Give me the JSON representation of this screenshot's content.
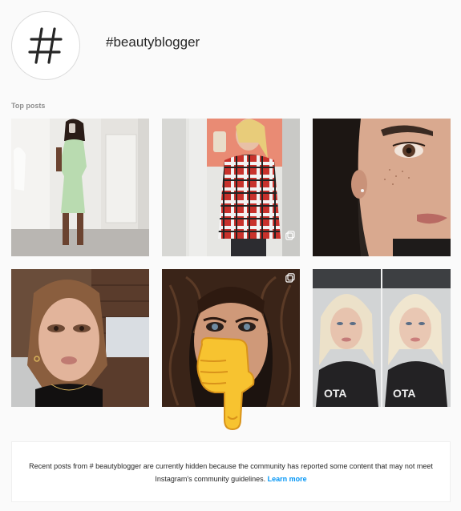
{
  "hashtag": {
    "title": "#beautyblogger",
    "icon": "hashtag-icon"
  },
  "top_posts": {
    "label": "Top posts",
    "posts": [
      {
        "subject": "woman in green dress mirror selfie"
      },
      {
        "subject": "woman in plaid shirt mirror selfie"
      },
      {
        "subject": "close-up of freckled face"
      },
      {
        "subject": "woman with smoky eye makeup"
      },
      {
        "subject": "woman with dramatic eye makeup"
      },
      {
        "subject": "blonde woman before and after"
      }
    ]
  },
  "overlay": {
    "icon": "pointing-down-emoji-icon"
  },
  "notice": {
    "line1": "Recent posts from # beautyblogger are currently hidden because the community has reported some content that may not meet",
    "line2": "Instagram's community guidelines.",
    "link": "Learn more"
  },
  "colors": {
    "background": "#fafafa",
    "link": "#0095f6",
    "muted": "#8e8e8e"
  }
}
